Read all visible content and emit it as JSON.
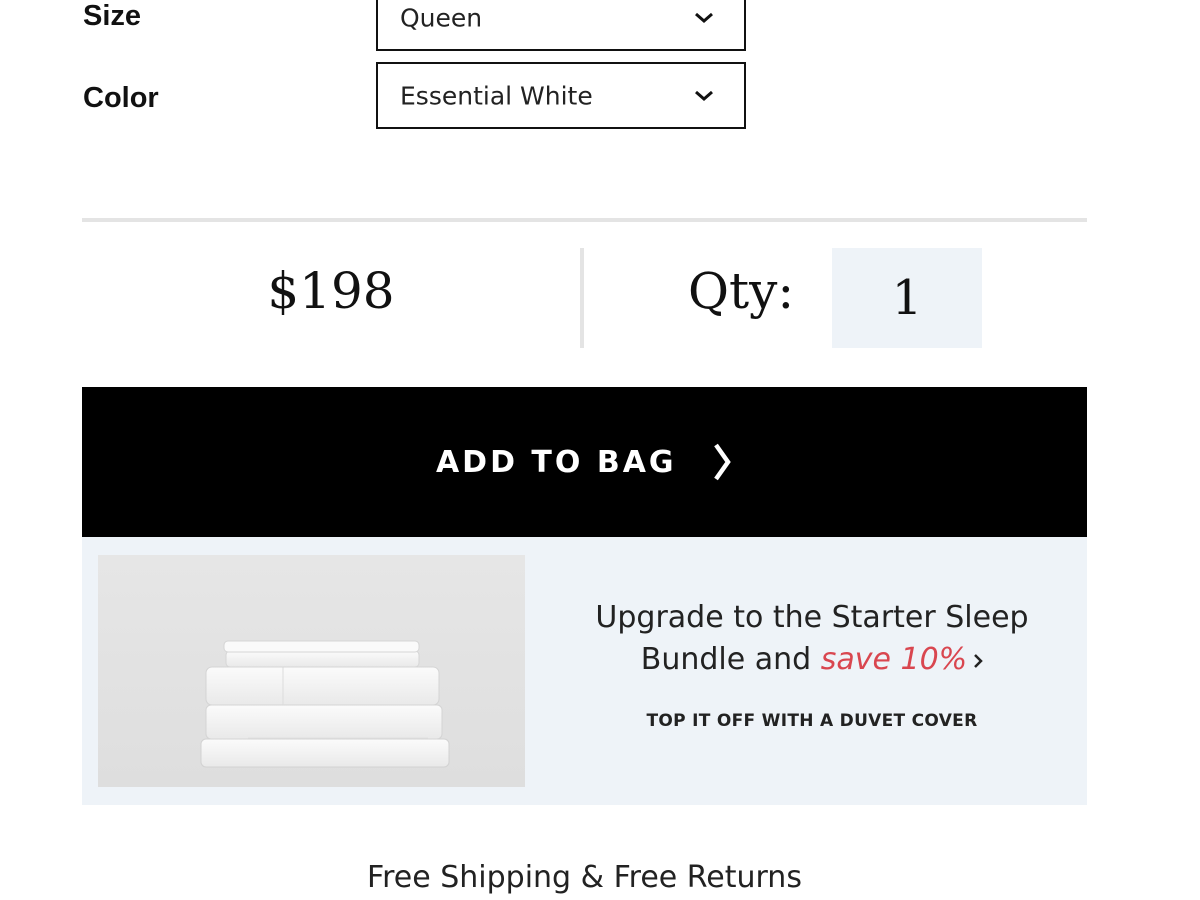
{
  "options": {
    "size": {
      "label": "Size",
      "value": "Queen"
    },
    "color": {
      "label": "Color",
      "value": "Essential White"
    }
  },
  "price": "$198",
  "quantity": {
    "label": "Qty:",
    "value": "1"
  },
  "add_to_bag": {
    "label": "ADD TO BAG"
  },
  "upsell": {
    "line1": "Upgrade to the Starter Sleep",
    "line2_prefix": "Bundle and",
    "save_text": "save 10%",
    "save_color": "#d9464f",
    "sub_link": "TOP IT OFF WITH A DUVET COVER",
    "image_icon": "folded-sheets-image"
  },
  "shipping_note": "Free Shipping & Free Returns",
  "colors": {
    "button_bg": "#000000",
    "panel_bg": "#eef3f8",
    "divider": "#e4e4e4"
  }
}
